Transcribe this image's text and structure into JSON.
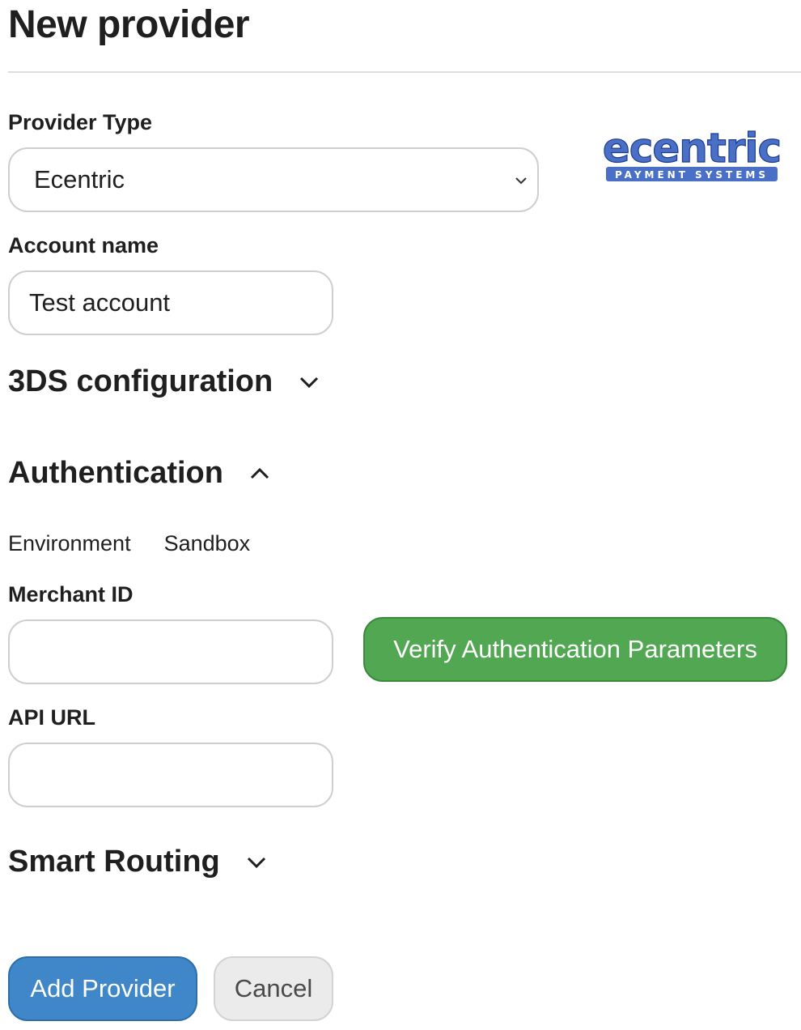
{
  "page": {
    "title": "New provider"
  },
  "provider_type": {
    "label": "Provider Type",
    "selected": "Ecentric",
    "logo": {
      "name": "ecentric",
      "tagline": "PAYMENT SYSTEMS",
      "color": "#4a6fc7"
    }
  },
  "account_name": {
    "label": "Account name",
    "value": "Test account"
  },
  "sections": {
    "three_ds": {
      "title": "3DS configuration",
      "icon": "chevron-down-icon"
    },
    "authentication": {
      "title": "Authentication",
      "icon": "chevron-up-icon"
    },
    "smart_routing": {
      "title": "Smart Routing",
      "icon": "chevron-down-icon"
    }
  },
  "environment": {
    "label": "Environment",
    "value": "Sandbox"
  },
  "merchant_id": {
    "label": "Merchant ID",
    "value": ""
  },
  "api_url": {
    "label": "API URL",
    "value": ""
  },
  "buttons": {
    "verify": "Verify Authentication Parameters",
    "add": "Add Provider",
    "cancel": "Cancel"
  },
  "colors": {
    "primary": "#3f87c8",
    "success": "#52a852",
    "secondary": "#ebebeb"
  }
}
